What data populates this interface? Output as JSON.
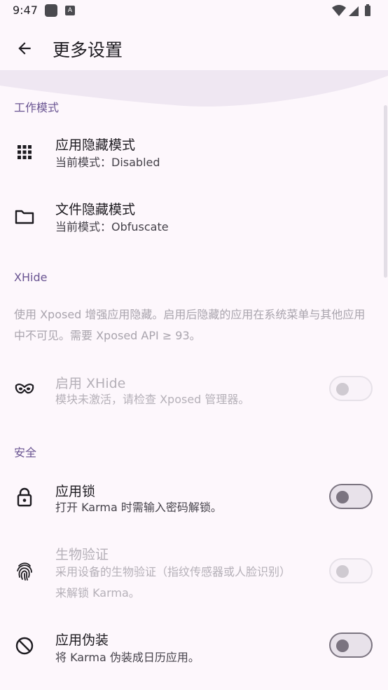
{
  "status_bar": {
    "time": "9:47",
    "icons": [
      "app-notification-icon",
      "a-notification-icon",
      "wifi-icon",
      "signal-icon",
      "battery-icon"
    ]
  },
  "app_bar": {
    "title": "更多设置",
    "back_icon": "arrow-back-icon"
  },
  "sections": {
    "work_mode": {
      "header": "工作模式",
      "items": [
        {
          "title": "应用隐藏模式",
          "subtitle": "当前模式：Disabled",
          "icon": "apps-grid-icon"
        },
        {
          "title": "文件隐藏模式",
          "subtitle": "当前模式：Obfuscate",
          "icon": "folder-icon"
        }
      ]
    },
    "xhide": {
      "header": "XHide",
      "description": "使用 Xposed 增强应用隐藏。启用后隐藏的应用在系统菜单与其他应用中不可见。需要 Xposed API ≥ 93。",
      "items": [
        {
          "title": "启用 XHide",
          "subtitle": "模块未激活，请检查 Xposed 管理器。",
          "icon": "mask-icon",
          "enabled": false,
          "checked": false
        }
      ]
    },
    "security": {
      "header": "安全",
      "items": [
        {
          "title": "应用锁",
          "subtitle": "打开 Karma 时需输入密码解锁。",
          "icon": "lock-icon",
          "enabled": true,
          "checked": false
        },
        {
          "title": "生物验证",
          "subtitle_line1": "采用设备的生物验证（指纹传感器或人脸识别）",
          "subtitle_line2": "来解锁 Karma。",
          "icon": "fingerprint-icon",
          "enabled": false,
          "checked": false
        },
        {
          "title": "应用伪装",
          "subtitle": "将 Karma 伪装成日历应用。",
          "icon": "disguise-icon",
          "enabled": true,
          "checked": false
        }
      ]
    }
  },
  "colors": {
    "background": "#fdf7fc",
    "accent": "#6a5592",
    "text_primary": "#1d1b20",
    "text_secondary": "#45424a",
    "text_disabled": "#b5b0b8"
  }
}
